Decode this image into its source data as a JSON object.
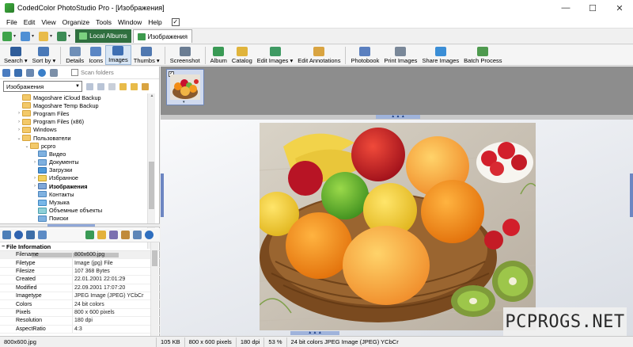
{
  "window": {
    "title": "CodedColor PhotoStudio Pro - [Изображения]",
    "minimize": "—",
    "maximize": "☐",
    "close": "✕"
  },
  "menu": [
    "File",
    "Edit",
    "View",
    "Organize",
    "Tools",
    "Window",
    "Help"
  ],
  "menu_check": "✓",
  "tabs": [
    {
      "label": "Local Albums"
    },
    {
      "label": "Изображения"
    }
  ],
  "toolbar": [
    {
      "label": "Search",
      "icon": "binoculars-icon",
      "dd": "▾"
    },
    {
      "label": "Sort by",
      "icon": "sort-icon",
      "dd": "▾"
    },
    {
      "label": "Details",
      "icon": "details-icon"
    },
    {
      "label": "Icons",
      "icon": "icons-view-icon"
    },
    {
      "label": "Images",
      "icon": "images-view-icon"
    },
    {
      "label": "Thumbs",
      "icon": "thumbs-view-icon",
      "dd": "▾"
    },
    {
      "label": "Screenshot",
      "icon": "screenshot-icon"
    },
    {
      "label": "Album",
      "icon": "album-icon"
    },
    {
      "label": "Catalog",
      "icon": "catalog-icon"
    },
    {
      "label": "Edit Images",
      "icon": "edit-images-icon",
      "dd": "▾"
    },
    {
      "label": "Edit Annotations",
      "icon": "edit-annotations-icon"
    },
    {
      "label": "Photobook",
      "icon": "photobook-icon"
    },
    {
      "label": "Print Images",
      "icon": "print-icon"
    },
    {
      "label": "Share Images",
      "icon": "share-icon"
    },
    {
      "label": "Batch Process",
      "icon": "batch-process-icon"
    }
  ],
  "folder_panel": {
    "scan_label": "Scan folders",
    "combo_value": "Изображения",
    "tree": [
      {
        "label": "Magoshare iCloud Backup",
        "indent": 2,
        "exp": "",
        "type": "fold"
      },
      {
        "label": "Magoshare Temp Backup",
        "indent": 2,
        "exp": "",
        "type": "fold"
      },
      {
        "label": "Program Files",
        "indent": 2,
        "exp": "›",
        "type": "fold"
      },
      {
        "label": "Program Files (x86)",
        "indent": 2,
        "exp": "›",
        "type": "fold"
      },
      {
        "label": "Windows",
        "indent": 2,
        "exp": "›",
        "type": "fold"
      },
      {
        "label": "Пользователи",
        "indent": 2,
        "exp": "⌄",
        "type": "fold"
      },
      {
        "label": "pcpro",
        "indent": 3,
        "exp": "⌄",
        "type": "fold"
      },
      {
        "label": "Видео",
        "indent": 4,
        "exp": "",
        "type": "sys"
      },
      {
        "label": "Документы",
        "indent": 4,
        "exp": "›",
        "type": "sys"
      },
      {
        "label": "Загрузки",
        "indent": 4,
        "exp": "",
        "type": "dl"
      },
      {
        "label": "Избранное",
        "indent": 4,
        "exp": "›",
        "type": "star"
      },
      {
        "label": "Изображения",
        "indent": 4,
        "exp": "›",
        "type": "img",
        "bold": true
      },
      {
        "label": "Контакты",
        "indent": 4,
        "exp": "",
        "type": "sys"
      },
      {
        "label": "Музыка",
        "indent": 4,
        "exp": "",
        "type": "music"
      },
      {
        "label": "Объемные объекты",
        "indent": 4,
        "exp": "",
        "type": "obj"
      },
      {
        "label": "Поиски",
        "indent": 4,
        "exp": "",
        "type": "sys"
      }
    ]
  },
  "file_info": {
    "header": "File Information",
    "header_toggle": "−",
    "rows": [
      {
        "k": "Filename",
        "v": "800x600.jpg"
      },
      {
        "k": "Filetype",
        "v": "Image (jpg) File"
      },
      {
        "k": "Filesize",
        "v": "107 368 Bytes"
      },
      {
        "k": "Created",
        "v": "22.01.2001 22:01:29"
      },
      {
        "k": "Modified",
        "v": "22.09.2001 17:07:20"
      },
      {
        "k": "Imagetype",
        "v": "JPEG Image (JPEG) YCbCr"
      },
      {
        "k": "Colors",
        "v": "24 bit colors"
      },
      {
        "k": "Pixels",
        "v": "800 x 600 pixels"
      },
      {
        "k": "Resolution",
        "v": "180 dpi"
      },
      {
        "k": "AspectRatio",
        "v": "4:3"
      }
    ]
  },
  "thumb": {
    "check": "✓",
    "dd": "▾"
  },
  "grips": {
    "top": "▲ ▲ ▲",
    "bottom": "▲ ▲ ▲"
  },
  "status": [
    "800x600.jpg",
    "105 KB",
    "800 x 600 pixels",
    "180 dpi",
    "53 %",
    "24 bit colors JPEG Image (JPEG) YCbCr"
  ],
  "watermark": "PCPROGS.NET",
  "colors": {
    "accent_green": "#2f6f3f",
    "selection_blue": "#d8e6f5",
    "strip_gray": "#8d8d8d"
  }
}
